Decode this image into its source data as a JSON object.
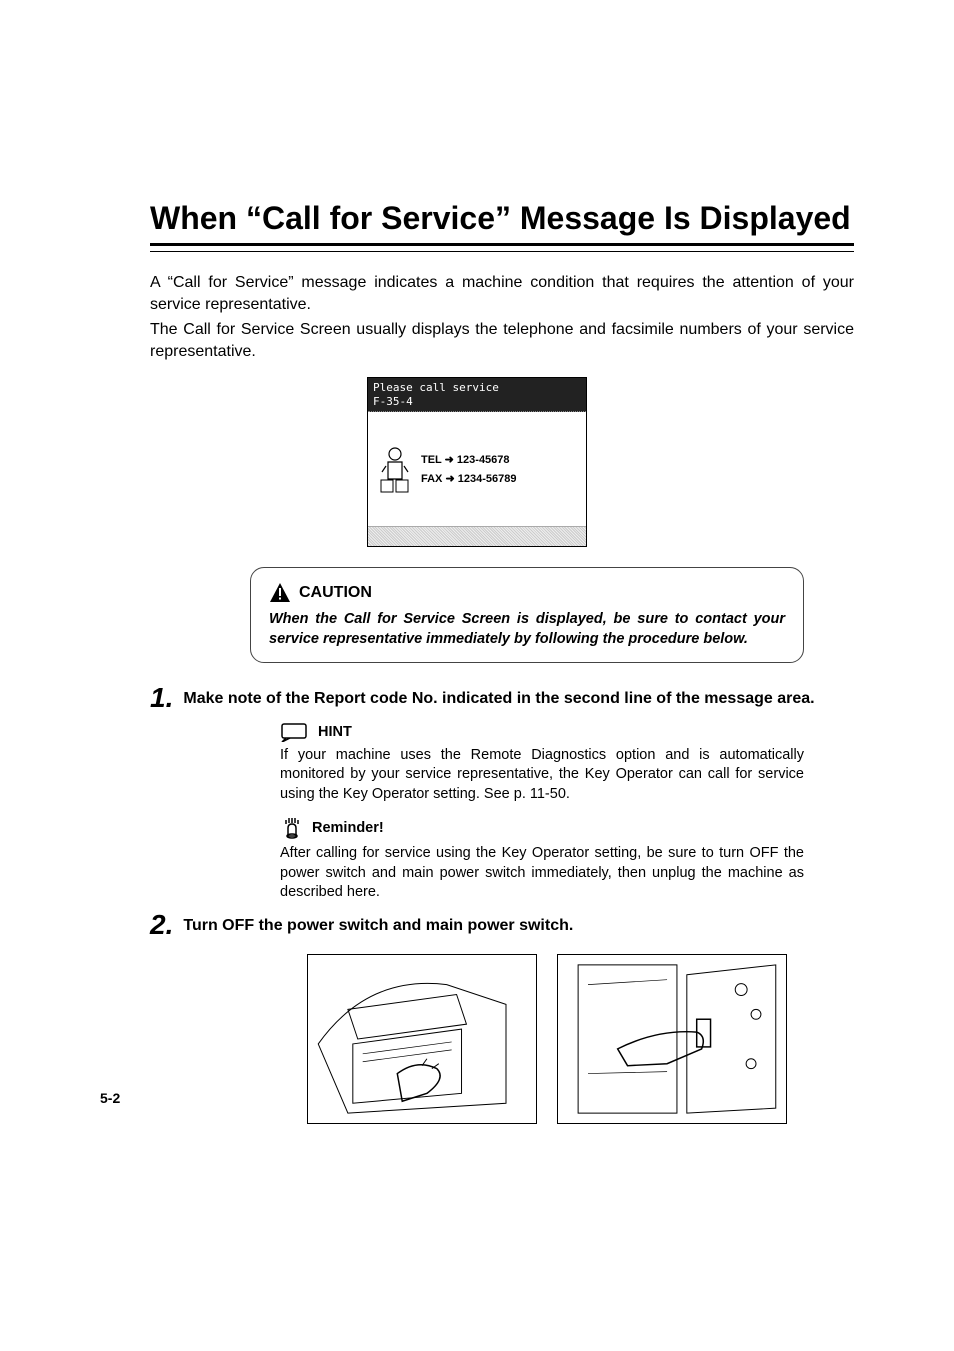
{
  "heading": "When “Call for Service” Message Is Displayed",
  "intro": {
    "p1": "A “Call for Service” message indicates a machine condition that requires the attention of your service representative.",
    "p2": "The Call for Service Screen usually displays the telephone and facsimile numbers of your service representative."
  },
  "screen": {
    "header_line1": "Please call service",
    "header_line2": "F-35-4",
    "tel_label": "TEL",
    "tel_value": "123-45678",
    "fax_label": "FAX",
    "fax_value": "1234-56789"
  },
  "caution": {
    "label": "CAUTION",
    "text": "When the Call for Service Screen is displayed, be sure to contact your service representative immediately by following the procedure below."
  },
  "steps": {
    "one": {
      "num": "1.",
      "text": "Make note of the Report code No. indicated in the second line of the message area."
    },
    "two": {
      "num": "2.",
      "text": "Turn OFF the power switch and main power switch."
    }
  },
  "hint": {
    "label": "HINT",
    "text": "If your machine uses the Remote Diagnostics option and is automatically monitored by your service representative, the Key Operator can call for service using the Key Operator setting. See p. 11-50."
  },
  "reminder": {
    "label": "Reminder!",
    "text": "After calling for service using the Key Operator setting, be sure to turn OFF the power switch and main power switch immediately, then unplug the machine as described here."
  },
  "page_number": "5-2"
}
